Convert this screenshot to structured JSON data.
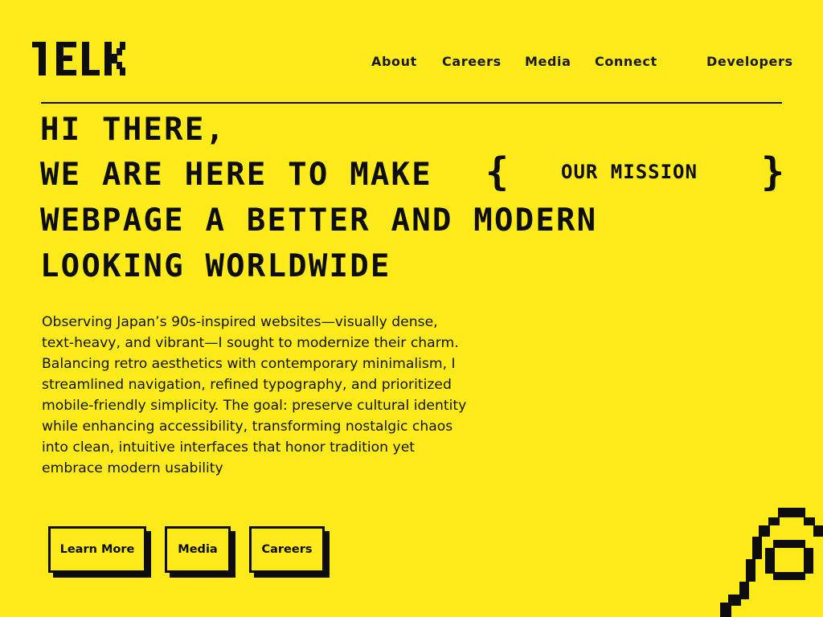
{
  "brand": {
    "logo_text": "ELK",
    "colors": {
      "background": "#FFEA1A",
      "ink": "#0D0D0D"
    }
  },
  "nav": {
    "items": [
      {
        "label": "About"
      },
      {
        "label": "Careers"
      },
      {
        "label": "Media"
      },
      {
        "label": "Connect"
      },
      {
        "label": "Developers"
      }
    ]
  },
  "hero": {
    "headline_lines": [
      "HI THERE,",
      "WE ARE HERE TO MAKE",
      "WEBPAGE A BETTER AND MODERN",
      "LOOKING WORLDWIDE"
    ],
    "mission": {
      "brace_left": "{",
      "label": "OUR MISSION",
      "brace_right": "}"
    },
    "intro_lines": [
      "Observing Japan’s 90s-inspired websites—visually dense,",
      "text-heavy, and vibrant—I sought to modernize their charm.",
      "Balancing retro aesthetics with contemporary minimalism, I",
      "streamlined navigation, refined typography, and prioritized",
      "mobile-friendly simplicity. The goal: preserve cultural identity",
      "while enhancing accessibility, transforming nostalgic chaos",
      "into clean, intuitive interfaces that honor tradition yet",
      "embrace modern usability"
    ]
  },
  "actions": {
    "buttons": [
      {
        "label": "Learn More"
      },
      {
        "label": "Media"
      },
      {
        "label": "Careers"
      }
    ]
  },
  "decor": {
    "mascot_icon": "pixel-ghost-icon"
  }
}
